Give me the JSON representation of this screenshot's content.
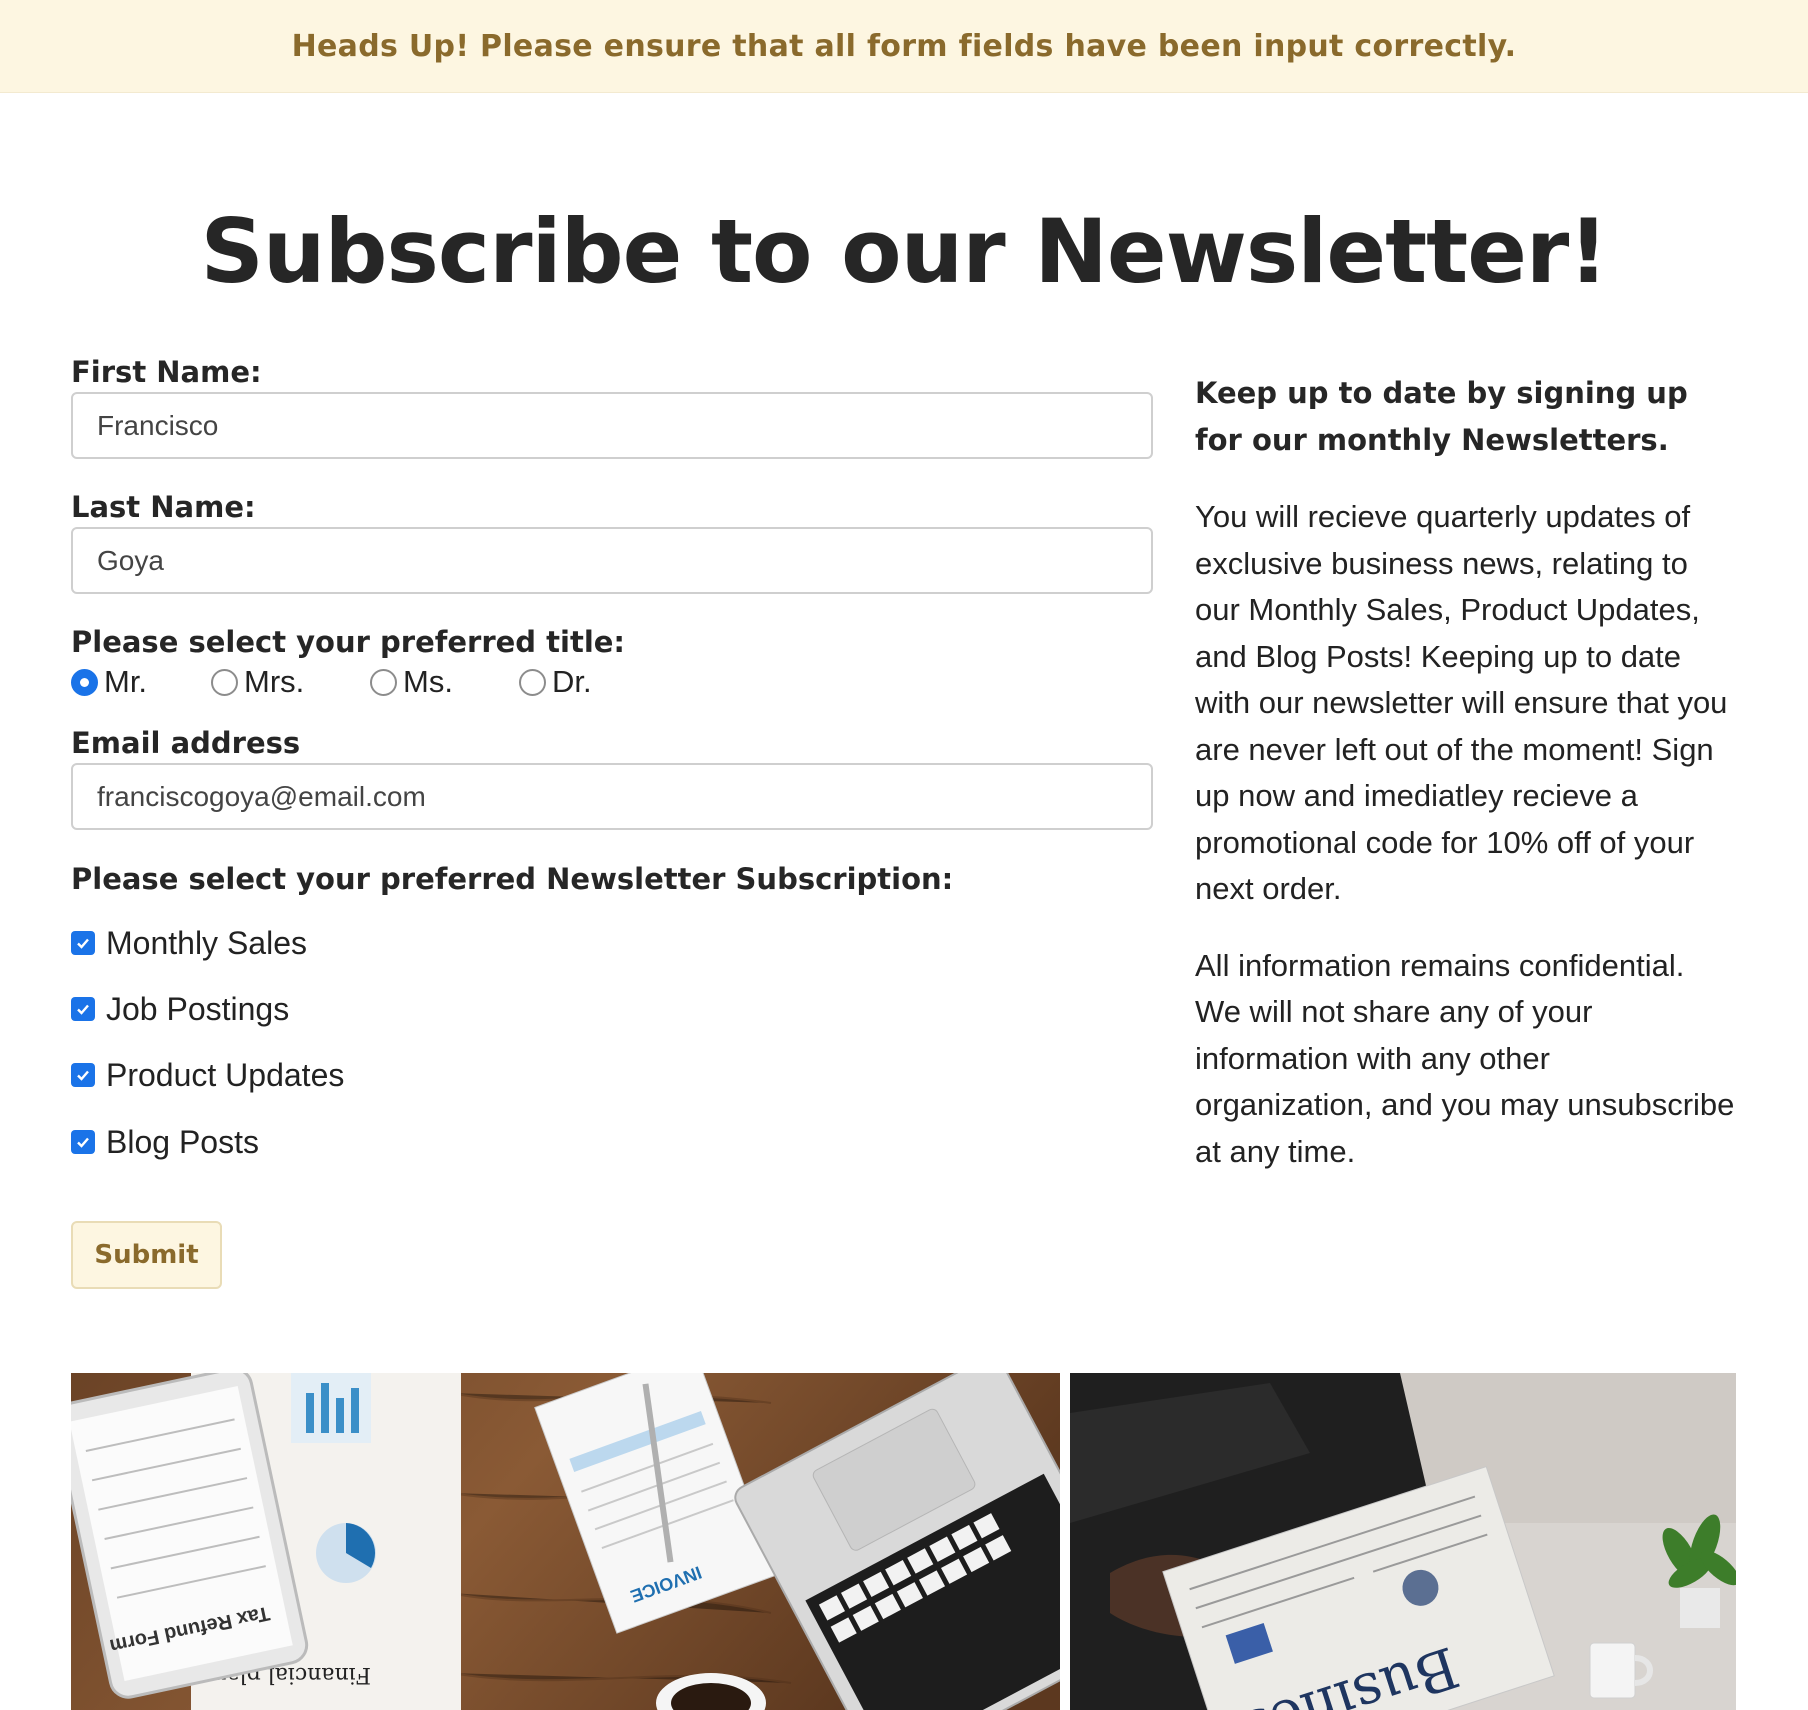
{
  "alert": {
    "text": "Heads Up! Please ensure that all form fields have been input correctly."
  },
  "title": "Subscribe to our Newsletter!",
  "form": {
    "first_name": {
      "label": "First Name:",
      "value": "Francisco"
    },
    "last_name": {
      "label": "Last Name:",
      "value": "Goya"
    },
    "title_select": {
      "label": "Please select your preferred title:",
      "options": [
        {
          "label": "Mr.",
          "checked": true
        },
        {
          "label": "Mrs.",
          "checked": false
        },
        {
          "label": "Ms.",
          "checked": false
        },
        {
          "label": "Dr.",
          "checked": false
        }
      ]
    },
    "email": {
      "label": "Email address",
      "value": "franciscogoya@email.com"
    },
    "subscriptions": {
      "label": "Please select your preferred Newsletter Subscription:",
      "items": [
        {
          "label": "Monthly Sales",
          "checked": true
        },
        {
          "label": "Job Postings",
          "checked": true
        },
        {
          "label": "Product Updates",
          "checked": true
        },
        {
          "label": "Blog Posts",
          "checked": true
        }
      ]
    },
    "submit_label": "Submit"
  },
  "sidebar": {
    "heading": "Keep up to date by signing up for our monthly Newsletters.",
    "paragraph_1": "You will recieve quarterly updates of exclusive business news, relating to our Monthly Sales, Product Updates, and Blog Posts! Keeping up to date with our newsletter will ensure that you are never left out of the moment! Sign up now and imediatley recieve a promotional code for 10% off of your next order.",
    "paragraph_2": "All information remains confidential. We will not share any of your information with any other organization, and you may unsubscribe at any time."
  },
  "images": {
    "desk_photo": {
      "text_tax_form": "Tax Refund Form",
      "text_plan": "Financial plan",
      "text_invoice": "INVOICE"
    },
    "newspaper_photo": {
      "text_headline": "Business"
    }
  },
  "colors": {
    "alert_bg": "#fdf6e1",
    "alert_text": "#8a6a2c",
    "accent_blue": "#1a73e8"
  }
}
